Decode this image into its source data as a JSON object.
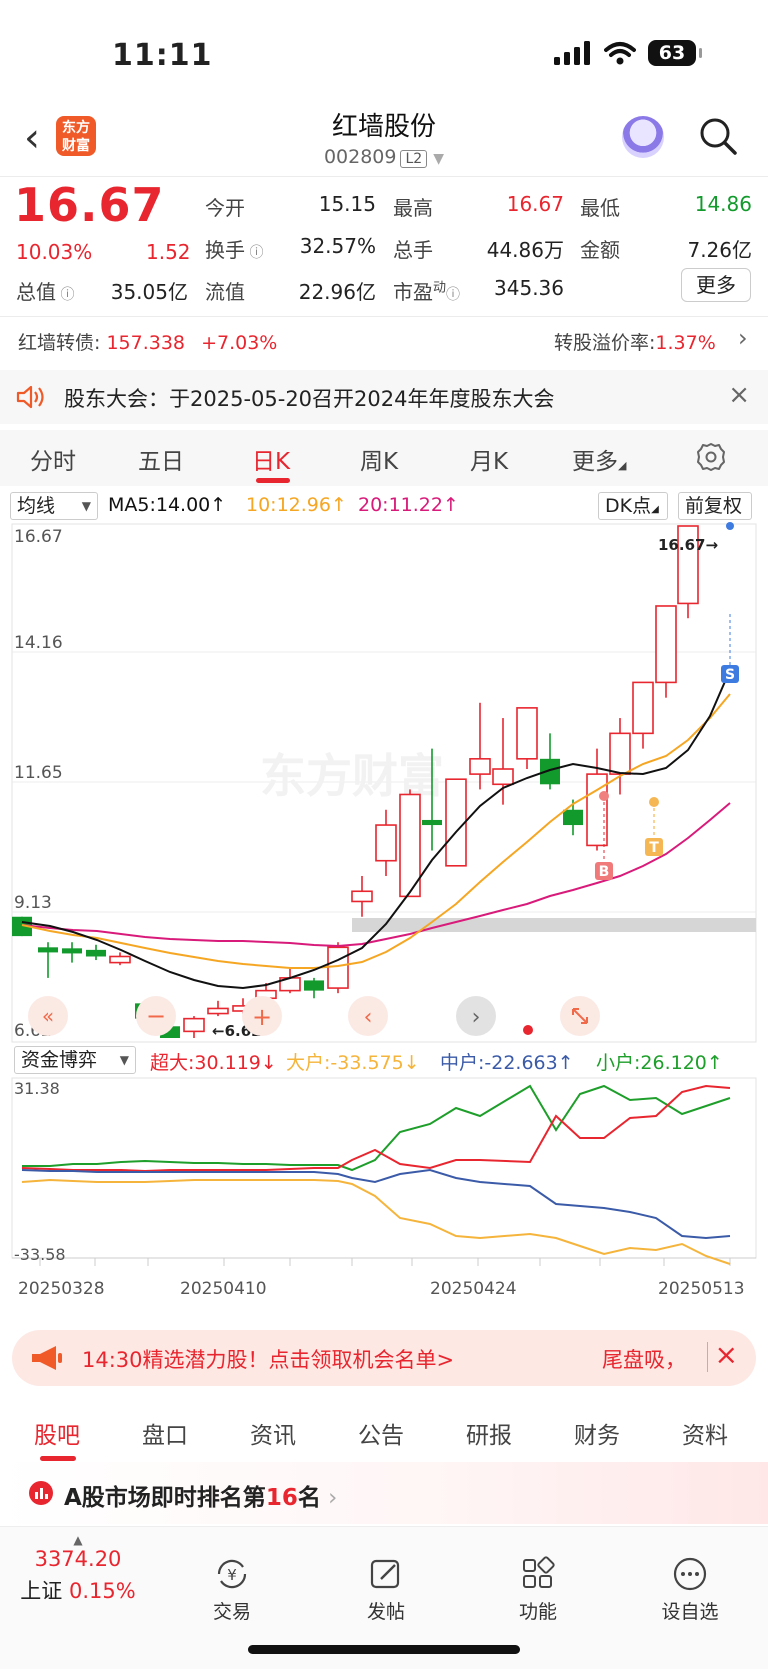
{
  "status": {
    "time": "11:11",
    "battery": "63"
  },
  "header": {
    "logo_line1": "东方",
    "logo_line2": "财富",
    "title": "红墙股份",
    "code": "002809",
    "level": "L2"
  },
  "quote": {
    "price": "16.67",
    "pct": "10.03%",
    "change": "1.52",
    "open_label": "今开",
    "open": "15.15",
    "high_label": "最高",
    "high": "16.67",
    "low_label": "最低",
    "low": "14.86",
    "turnover_label": "换手",
    "turnover": "32.57%",
    "volume_label": "总手",
    "volume": "44.86万",
    "amount_label": "金额",
    "amount": "7.26亿",
    "mktcap_label": "总值",
    "mktcap": "35.05亿",
    "float_label": "流值",
    "float": "22.96亿",
    "pe_label": "市盈",
    "pe_sup": "动",
    "pe": "345.36",
    "more": "更多"
  },
  "bond": {
    "label": "红墙转债:",
    "price": "157.338",
    "pct": "+7.03%",
    "premium_label": "转股溢价率:",
    "premium": "1.37%"
  },
  "notice": {
    "text": "股东大会：于2025-05-20召开2024年年度股东大会"
  },
  "tabs": [
    "分时",
    "五日",
    "日K",
    "周K",
    "月K",
    "更多"
  ],
  "ma": {
    "selector": "均线",
    "ma5": "MA5:14.00↑",
    "ma10": "10:12.96↑",
    "ma20": "20:11.22↑",
    "dk": "DK点",
    "adj": "前复权"
  },
  "kchart": {
    "y_labels": [
      "16.67",
      "14.16",
      "11.65",
      "9.13",
      "6.62"
    ],
    "last_label": "16.67→",
    "min_label": "←6.62",
    "mark_s": "S",
    "mark_b": "B",
    "mark_t": "T",
    "watermark": "东方财富"
  },
  "flow": {
    "selector": "资金博弈",
    "super": "超大:30.119↓",
    "big": "大户:-33.575↓",
    "mid": "中户:-22.663↑",
    "small": "小户:26.120↑",
    "y_top": "31.38",
    "y_bottom": "-33.58",
    "dates": [
      "20250328",
      "20250410",
      "20250424",
      "20250513"
    ]
  },
  "banner": {
    "text": "14:30精选潜力股！点击领取机会名单>",
    "tail": "尾盘吸，"
  },
  "bottom_tabs": [
    "股吧",
    "盘口",
    "资讯",
    "公告",
    "研报",
    "财务",
    "资料"
  ],
  "rank": {
    "prefix": "A股市场即时排名第",
    "num": "16",
    "suffix": "名"
  },
  "index": {
    "value": "3374.20",
    "name": "上证",
    "pct": "0.15%"
  },
  "nav": [
    "交易",
    "发帖",
    "功能",
    "设自选"
  ],
  "colors": {
    "up": "#e8262f",
    "down": "#129a2c",
    "ma5": "#111111",
    "ma10": "#f5a623",
    "ma20": "#d81b7a",
    "mid_flow": "#3b5ba8"
  }
}
